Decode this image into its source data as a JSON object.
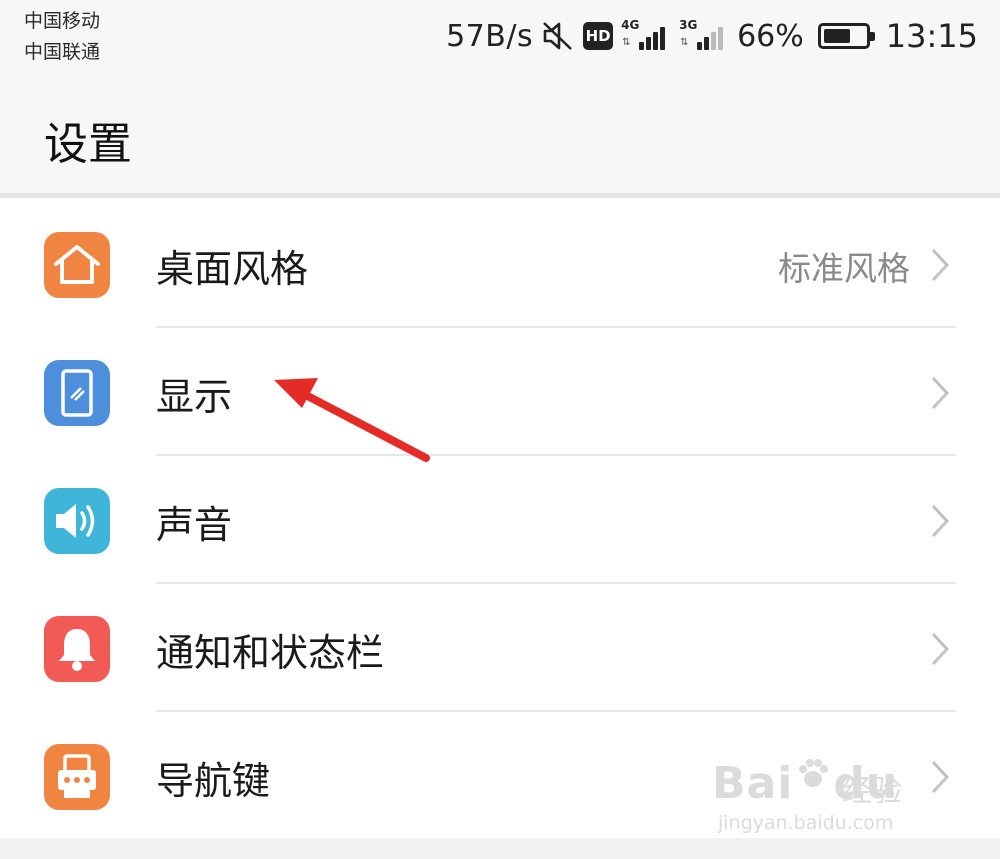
{
  "status_bar": {
    "carrier_1": "中国移动",
    "carrier_2": "中国联通",
    "net_speed": "57B/s",
    "hd_label": "HD",
    "sim1_network": "4G",
    "sim2_network": "3G",
    "battery_percent": "66%",
    "battery_level": 0.66,
    "time": "13:15",
    "icons": [
      "mute-icon",
      "hd-icon",
      "signal-icon",
      "battery-icon"
    ]
  },
  "page": {
    "title": "设置"
  },
  "settings_items": [
    {
      "label": "桌面风格",
      "value": "标准风格",
      "icon": "home-icon",
      "color": "#f08541"
    },
    {
      "label": "显示",
      "value": "",
      "icon": "display-icon",
      "color": "#4e8fdc"
    },
    {
      "label": "声音",
      "value": "",
      "icon": "speaker-icon",
      "color": "#3fb6d9"
    },
    {
      "label": "通知和状态栏",
      "value": "",
      "icon": "bell-icon",
      "color": "#f25b55"
    },
    {
      "label": "导航键",
      "value": "",
      "icon": "navigation-key-icon",
      "color": "#f08541"
    }
  ],
  "annotation": {
    "color": "#e52b25"
  },
  "watermark": {
    "brand": "Bai",
    "brand_suffix": "du",
    "name": "经验",
    "url": "jingyan.baidu.com"
  }
}
